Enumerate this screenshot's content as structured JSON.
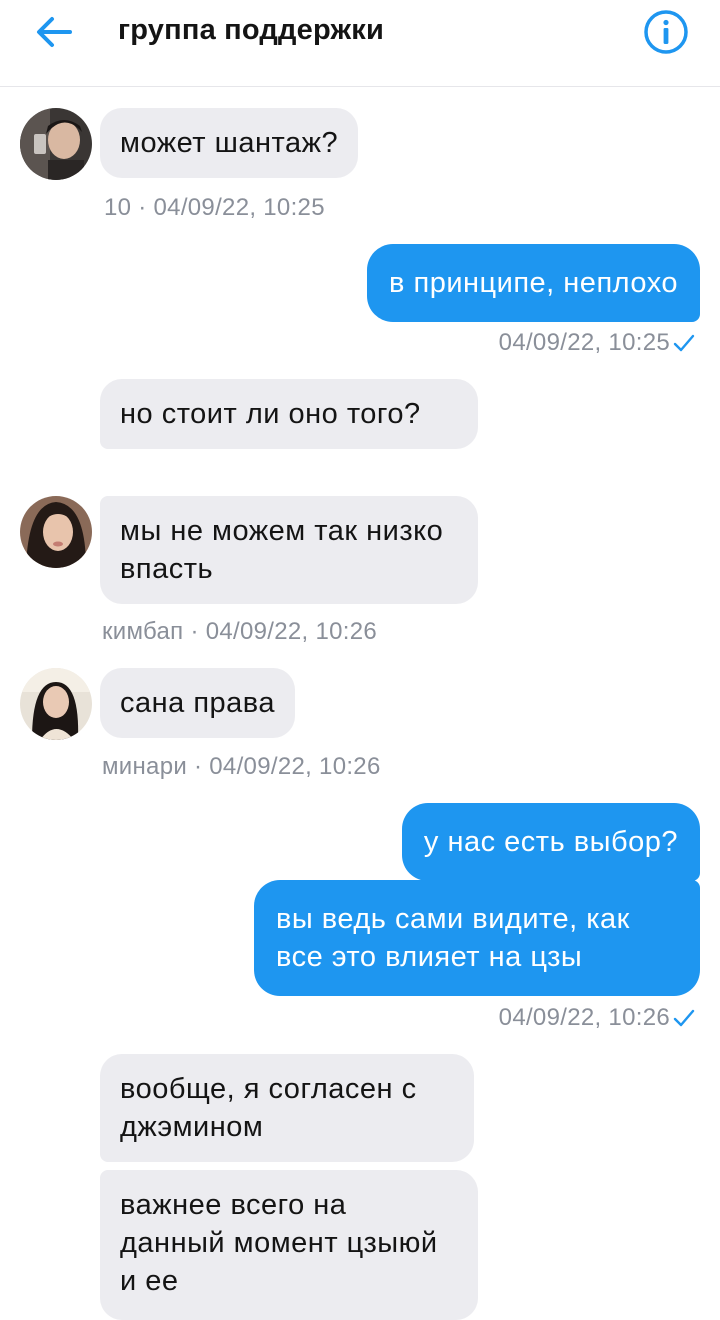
{
  "header": {
    "title": "группа поддержки",
    "back_icon": "arrow-left-icon",
    "info_icon": "info-icon",
    "accent_color": "#1e96f0"
  },
  "messages": [
    {
      "direction": "incoming",
      "text": "может шантаж?"
    },
    {
      "direction": "incoming-meta",
      "meta": "10 · 04/09/22, 10:25"
    },
    {
      "direction": "outgoing",
      "text": "в принципе, неплохо"
    },
    {
      "direction": "outgoing-meta",
      "meta": "04/09/22, 10:25",
      "status_icon": "checkmark-icon"
    },
    {
      "direction": "incoming",
      "text": "но стоит ли оно того?"
    },
    {
      "direction": "incoming",
      "text": "мы не можем так низко впасть"
    },
    {
      "direction": "incoming-meta",
      "meta": "кимбап · 04/09/22, 10:26"
    },
    {
      "direction": "incoming",
      "text": "сана права"
    },
    {
      "direction": "incoming-meta",
      "meta": "минари · 04/09/22, 10:26"
    },
    {
      "direction": "outgoing",
      "text": "у нас есть выбор?"
    },
    {
      "direction": "outgoing",
      "text": "вы ведь сами видите, как все это влияет на цзы"
    },
    {
      "direction": "outgoing-meta",
      "meta": "04/09/22, 10:26",
      "status_icon": "checkmark-icon"
    },
    {
      "direction": "incoming",
      "text": "вообще, я согласен с джэмином"
    },
    {
      "direction": "incoming",
      "text": "важнее всего на данный момент цзыюй и ее"
    }
  ]
}
